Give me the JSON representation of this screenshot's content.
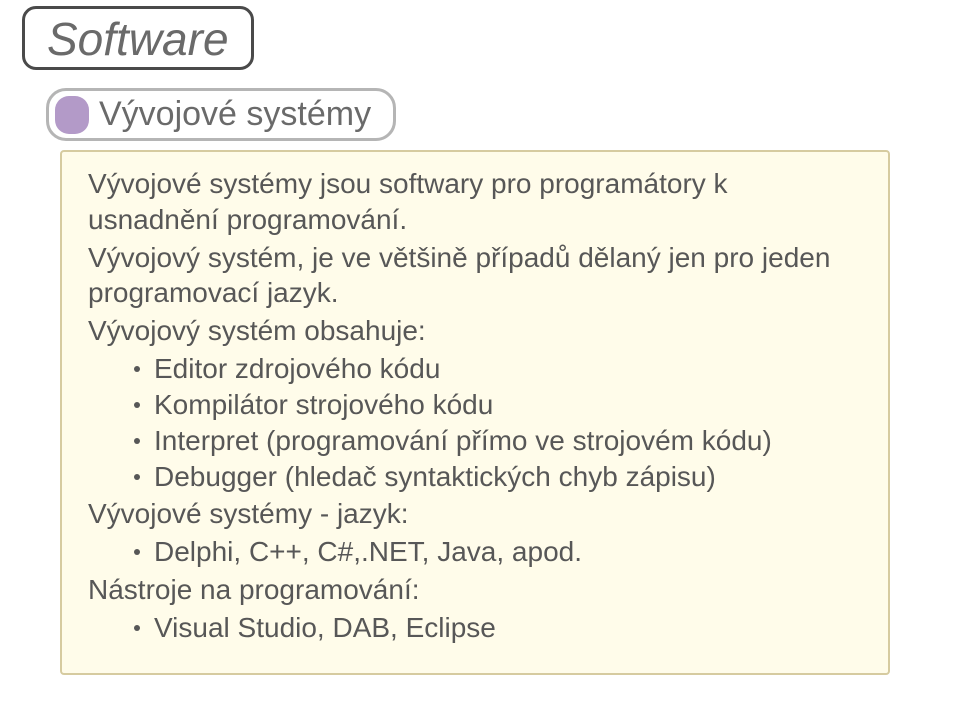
{
  "tab": {
    "title": "Software"
  },
  "subtitle": {
    "text": "Vývojové systémy"
  },
  "body": {
    "p1": "Vývojové systémy jsou softwary pro programátory k usnadnění programování.",
    "p2": "Vývojový systém, je ve většině případů dělaný jen pro jeden programovací jazyk.",
    "p3": "Vývojový systém obsahuje:",
    "b1": "Editor zdrojového kódu",
    "b2": "Kompilátor strojového kódu",
    "b3": "Interpret (programování přímo ve strojovém kódu)",
    "b4": "Debugger (hledač syntaktických chyb zápisu)",
    "p4": "Vývojové systémy - jazyk:",
    "b5": "Delphi, C++, C#,.NET, Java, apod.",
    "p5": "Nástroje na programování:",
    "b6": "Visual Studio, DAB, Eclipse"
  }
}
